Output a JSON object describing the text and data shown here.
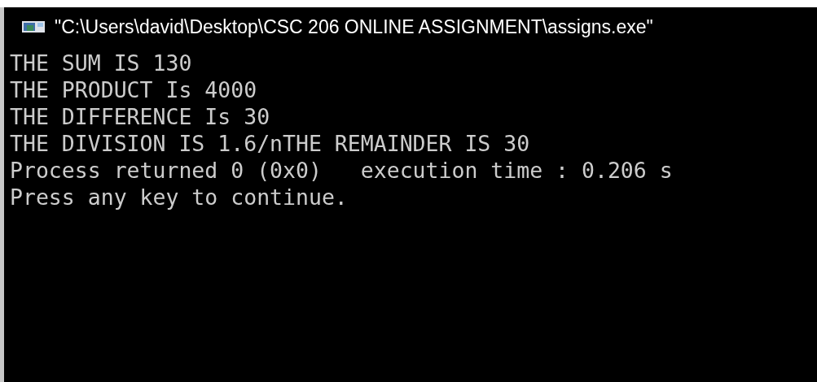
{
  "window": {
    "title": "\"C:\\Users\\david\\Desktop\\CSC 206 ONLINE ASSIGNMENT\\assigns.exe\""
  },
  "console": {
    "lines": [
      "THE SUM IS 130",
      "THE PRODUCT Is 4000",
      "THE DIFFERENCE Is 30",
      "THE DIVISION IS 1.6/nTHE REMAINDER IS 30",
      "Process returned 0 (0x0)   execution time : 0.206 s",
      "Press any key to continue."
    ]
  }
}
